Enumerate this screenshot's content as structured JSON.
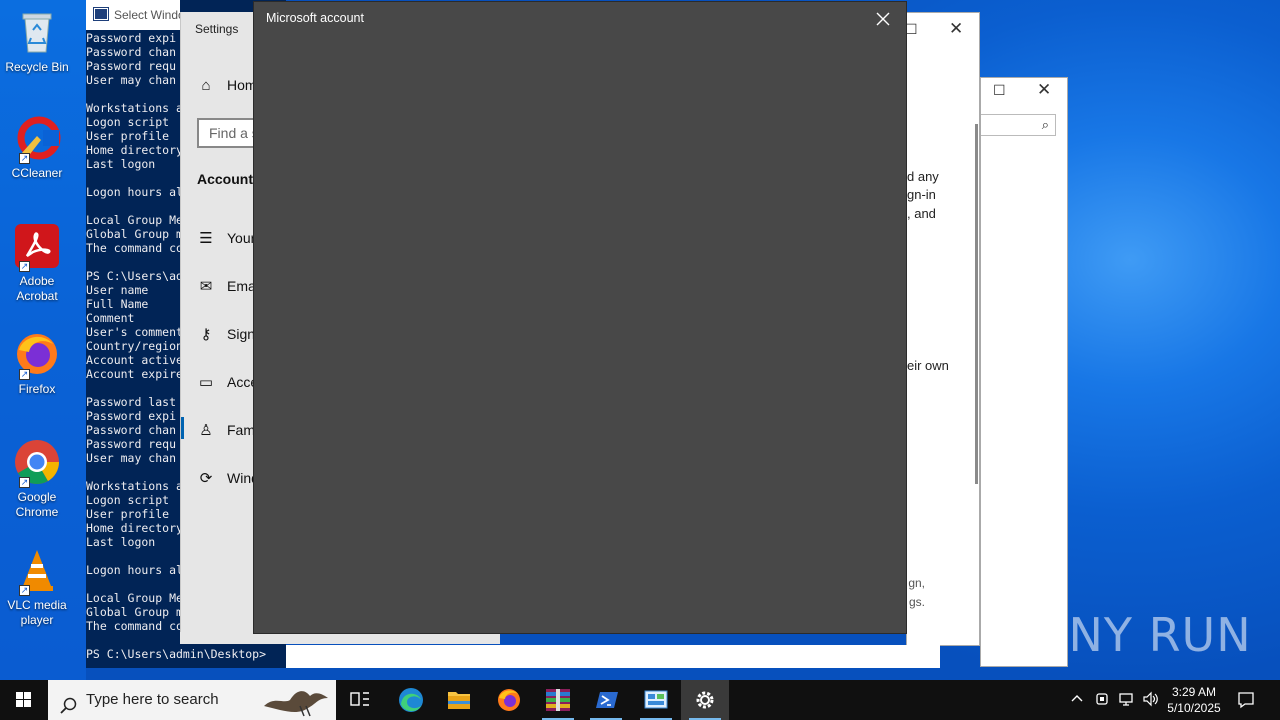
{
  "desktop": {
    "icons": [
      {
        "label": "Recycle Bin"
      },
      {
        "label": "CCleaner"
      },
      {
        "label": "Adobe Acrobat"
      },
      {
        "label": "Firefox"
      },
      {
        "label": "Google Chrome"
      },
      {
        "label": "VLC media player"
      }
    ]
  },
  "powershell": {
    "title": "Select Windo",
    "lines_top": [
      "Password expi",
      "Password chan",
      "Password requ",
      "User may chan",
      "",
      "Workstations a",
      "Logon script",
      "User profile",
      "Home directory",
      "Last logon",
      "",
      "Logon hours al",
      "",
      "Local Group Me",
      "Global Group m",
      "The command co",
      "",
      "PS C:\\Users\\ad",
      "User name",
      "Full Name",
      "Comment",
      "User's comment",
      "Country/region",
      "Account active",
      "Account expire",
      "",
      "Password last",
      "Password expi",
      "Password chan",
      "Password requ",
      "User may chan",
      "",
      "Workstations a",
      "Logon script",
      "User profile",
      "Home directory",
      "Last logon",
      "",
      "Logon hours al",
      "",
      "Local Group Me",
      "Global Group m",
      "The command co"
    ],
    "prompt": "PS C:\\Users\\admin\\Desktop>"
  },
  "settings": {
    "title": "Settings",
    "home": "Home",
    "find_placeholder": "Find a setting",
    "section": "Accounts",
    "nav": [
      {
        "label": "Your info"
      },
      {
        "label": "Email & accounts"
      },
      {
        "label": "Sign-in options"
      },
      {
        "label": "Access work or school"
      },
      {
        "label": "Family & other users"
      },
      {
        "label": "Windows backup"
      }
    ]
  },
  "back_window": {
    "text_lines": [
      "d any",
      "gn-in",
      ", and"
    ],
    "text_line2": "eir own",
    "small_lines": [
      "gn,",
      "gs."
    ]
  },
  "dialog": {
    "title": "Microsoft account"
  },
  "taskbar": {
    "search_placeholder": "Type here to search",
    "time": "3:29 AM",
    "date": "5/10/2025"
  },
  "watermark": "ANY RUN"
}
